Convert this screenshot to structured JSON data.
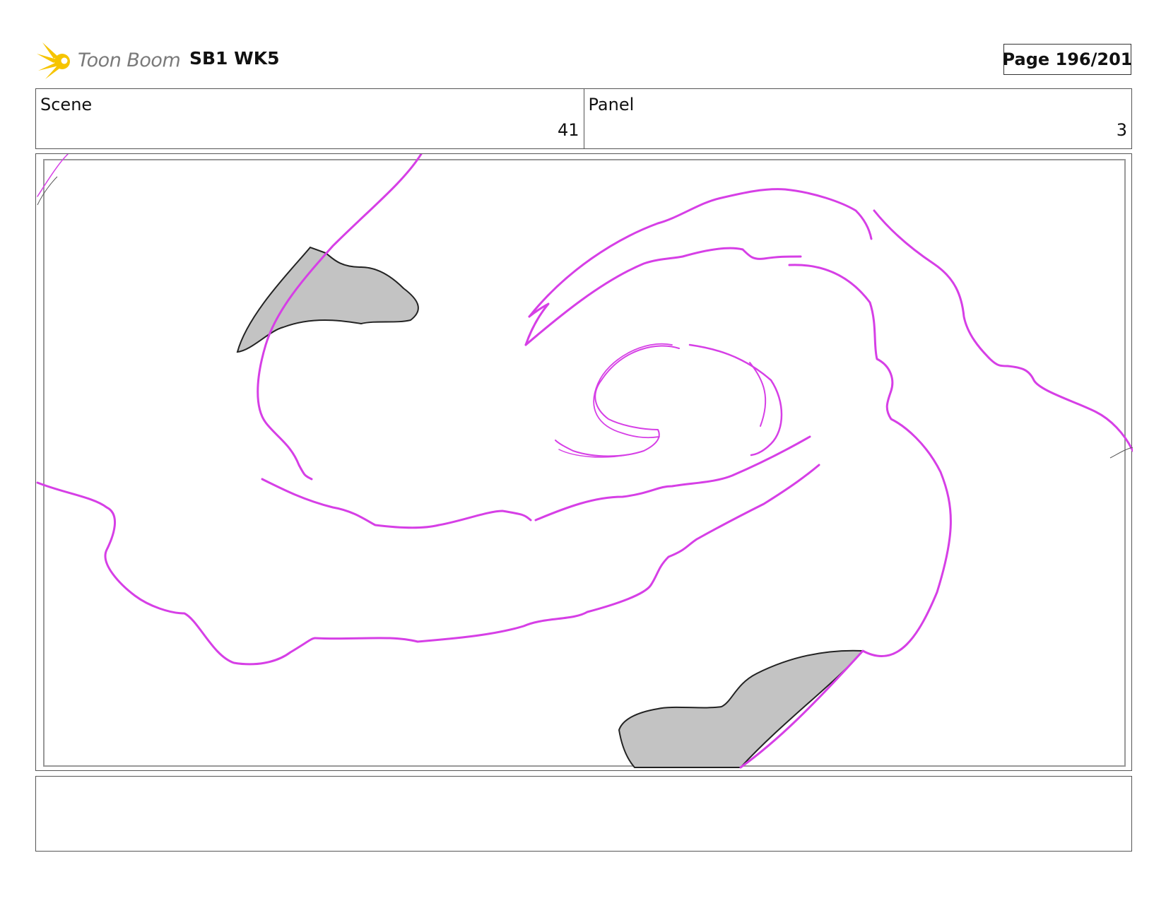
{
  "header": {
    "logo_text": "Toon Boom",
    "project_title": "SB1 WK5",
    "page_label": "Page 196/201"
  },
  "info": {
    "scene_label": "Scene",
    "scene_value": "41",
    "panel_label": "Panel",
    "panel_value": "3"
  },
  "notes": {
    "text": ""
  },
  "colors": {
    "line_magenta": "#d63fe6",
    "fill_grey": "#c3c3c3",
    "logo_yellow": "#f6c400",
    "logo_text": "#7a7a7a"
  },
  "icons": [
    "toon-boom-logo-icon"
  ]
}
